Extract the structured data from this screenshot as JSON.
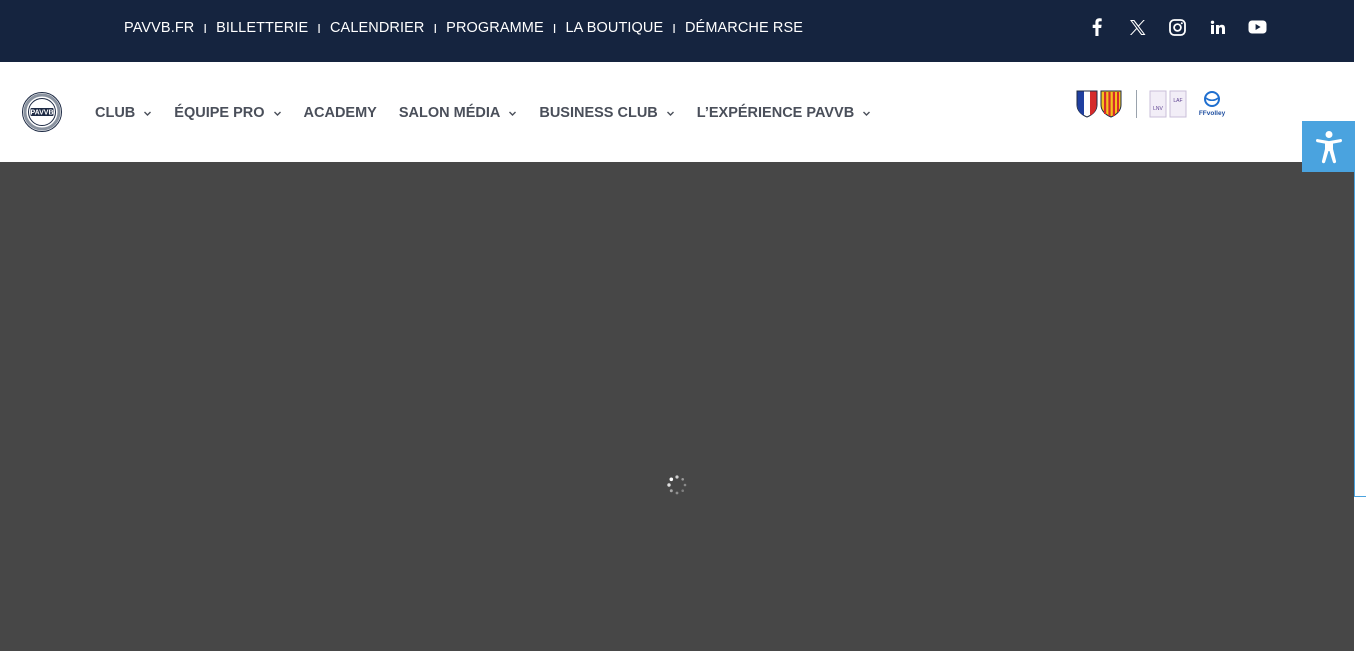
{
  "topbar": {
    "links": [
      "PAVVB.FR",
      "BILLETTERIE",
      "CALENDRIER",
      "PROGRAMME",
      "LA BOUTIQUE",
      "DÉMARCHE RSE"
    ],
    "separator": "I",
    "social": [
      "facebook-icon",
      "x-icon",
      "instagram-icon",
      "linkedin-icon",
      "youtube-icon"
    ]
  },
  "nav": {
    "logo_text": "PAVVB",
    "items": [
      {
        "label": "CLUB",
        "has_dropdown": true
      },
      {
        "label": "ÉQUIPE PRO",
        "has_dropdown": true
      },
      {
        "label": "ACADEMY",
        "has_dropdown": false
      },
      {
        "label": "SALON MÉDIA",
        "has_dropdown": true
      },
      {
        "label": "BUSINESS CLUB",
        "has_dropdown": true
      },
      {
        "label": "L’EXPÉRIENCE PAVVB",
        "has_dropdown": true
      }
    ],
    "partners": {
      "lnv": "LNV",
      "laf": "LAF",
      "ffvolley": "FFvolley"
    }
  },
  "accessibility": {
    "icon": "accessibility-icon"
  },
  "colors": {
    "topbar_bg": "#15243f",
    "nav_text": "#4a4f5a",
    "accent": "#4aa3df",
    "content_bg": "#474747"
  }
}
